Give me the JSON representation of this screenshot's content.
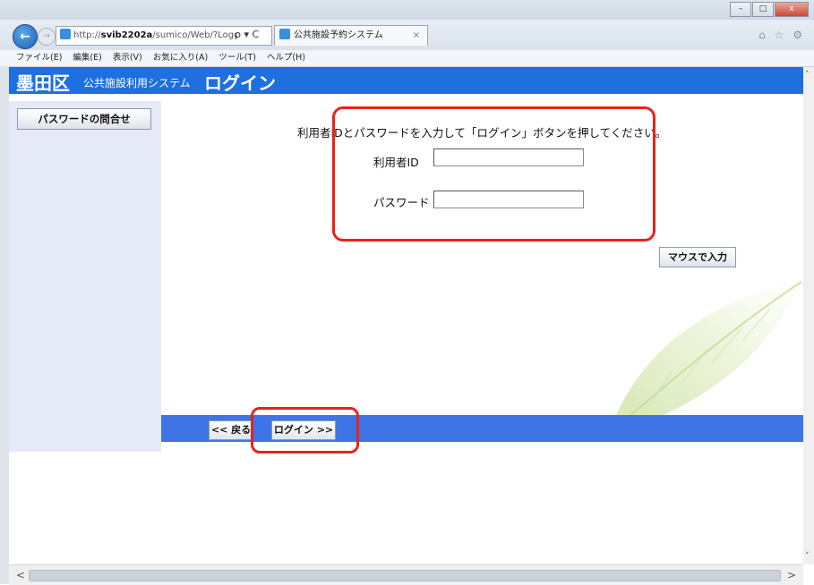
{
  "browser": {
    "address_prefix": "http://",
    "address_host": "svib2202a",
    "address_path": "/sumico/Web/?Logc",
    "address_tools": "ρ ▾ C",
    "tab_title": "公共施設予約システム",
    "tab_close": "×",
    "back_glyph": "←",
    "fwd_glyph": "→",
    "toolbar_icons": "⌂ ☆ ⚙",
    "window_minimize": "–",
    "window_maximize": "□",
    "window_close": "x"
  },
  "menu": [
    "ファイル(E)",
    "編集(E)",
    "表示(V)",
    "お気に入り(A)",
    "ツール(T)",
    "ヘルプ(H)"
  ],
  "header": {
    "ward": "墨田区",
    "system": "公共施設利用システム",
    "login": "ログイン"
  },
  "sidebar": {
    "password_inquiry": "パスワードの問合せ"
  },
  "form": {
    "instruction": "利用者IDとパスワードを入力して「ログイン」ボタンを押してください。",
    "user_id_label": "利用者ID",
    "user_id_value": "",
    "password_label": "パスワード",
    "password_value": "",
    "mouse_input": "マウスで入力"
  },
  "footer": {
    "back": "<< 戻る",
    "login": "ログイン >>"
  },
  "scrollbar": {
    "up": "˄",
    "down": "˅",
    "left": "<",
    "right": ">"
  },
  "colors": {
    "header_blue": "#1e6fe0",
    "footer_blue": "#3e74e6",
    "sidebar_bg": "#e6eaf8",
    "highlight_red": "#e8231b"
  }
}
